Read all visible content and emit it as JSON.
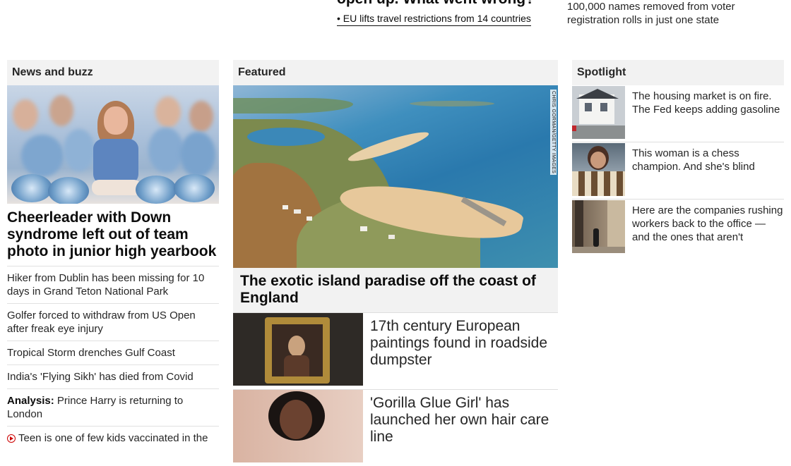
{
  "top": {
    "headline": "open up. What went wrong?",
    "sublink": "• EU lifts travel restrictions from 14 countries",
    "right_text": "100,000 names removed from voter registration rolls in just one state"
  },
  "news": {
    "header": "News and buzz",
    "lead": "Cheerleader with Down syndrome left out of team photo in junior high yearbook",
    "items": [
      {
        "prefix": "",
        "text": "Hiker from Dublin has been missing for 10 days in Grand Teton National Park"
      },
      {
        "prefix": "",
        "text": "Golfer forced to withdraw from US Open after freak eye injury"
      },
      {
        "prefix": "",
        "text": "Tropical Storm drenches Gulf Coast"
      },
      {
        "prefix": "",
        "text": "India's 'Flying Sikh' has died from Covid"
      },
      {
        "prefix": "Analysis:",
        "text": " Prince Harry is returning to London"
      },
      {
        "prefix": "",
        "text": "Teen is one of few kids vaccinated in the"
      }
    ],
    "icons": {
      "video": "play-circle-icon",
      "video_color": "#cc0000"
    }
  },
  "featured": {
    "header": "Featured",
    "photo_credit": "CHRIS GORMAN/GETTY IMAGES",
    "headline": "The exotic island paradise off the coast of England",
    "rows": [
      {
        "text": "17th century European paintings found in roadside dumpster"
      },
      {
        "text": "'Gorilla Glue Girl' has launched her own hair care line"
      }
    ]
  },
  "spotlight": {
    "header": "Spotlight",
    "items": [
      {
        "text": "The housing market is on fire. The Fed keeps adding gasoline"
      },
      {
        "text": "This woman is a chess champion. And she's blind"
      },
      {
        "text": "Here are the companies rushing workers back to the office — and the ones that aren't"
      }
    ]
  },
  "colors": {
    "section_header_bg": "#f2f2f2",
    "divider": "#e1e1e1",
    "text": "#262626",
    "headline": "#0c0c0c"
  }
}
